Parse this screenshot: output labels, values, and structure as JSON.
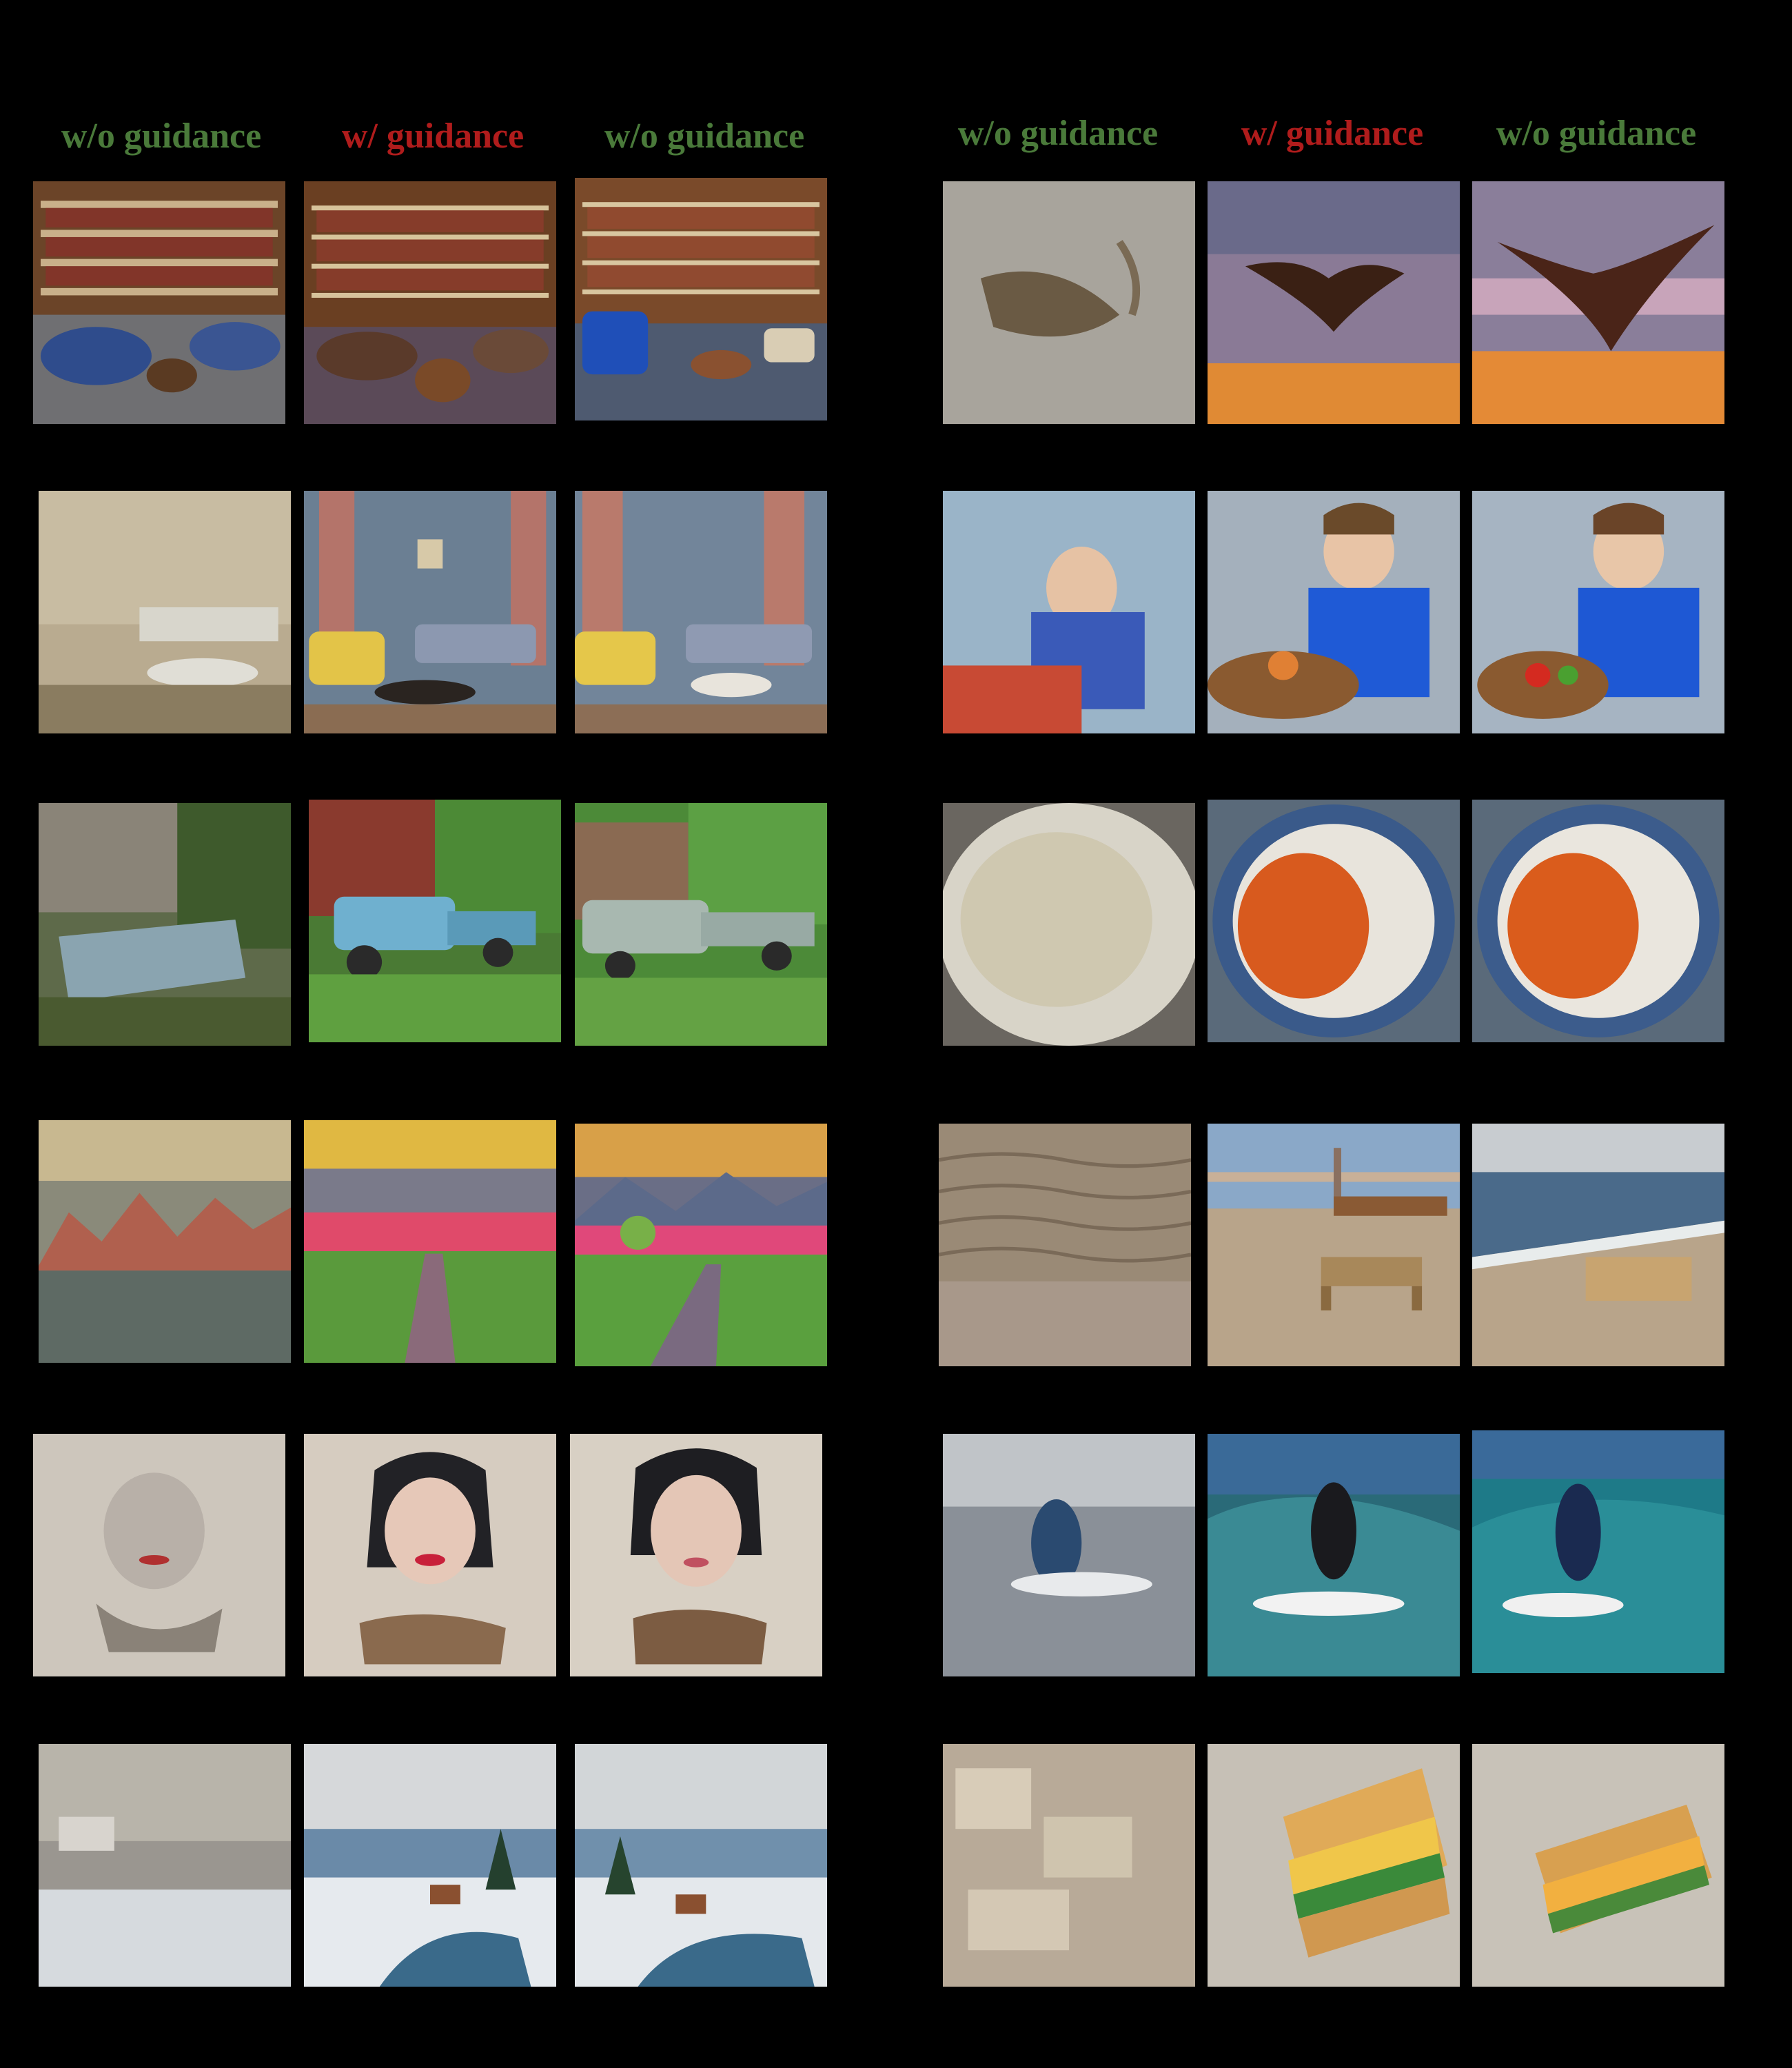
{
  "headers": {
    "left": [
      "w/o guidance",
      "w/ guidance",
      "w/o guidance"
    ],
    "right": [
      "w/o guidance",
      "w/ guidance",
      "w/o guidance"
    ]
  },
  "colors": {
    "header_without_guidance": "#4a7a3a",
    "header_with_guidance": "#b01c1c",
    "background": "#000000"
  },
  "grid": {
    "left": [
      [
        "library-interior-unguided",
        "library-interior-guided",
        "library-interior-unguided-2"
      ],
      [
        "living-room-sketchy",
        "living-room-pink-curtains",
        "living-room-pink-curtains-2"
      ],
      [
        "abandoned-truck-overgrown",
        "blue-pickup-truck-grass",
        "rusty-pickup-truck-barn"
      ],
      [
        "abstract-mountain-landscape",
        "sunset-dirt-road-painting",
        "sunset-road-tree-painting"
      ],
      [
        "sketch-woman-face",
        "watercolor-woman-portrait",
        "watercolor-woman-portrait-2"
      ],
      [
        "hazy-winter-cabin",
        "winter-river-cabin-painting",
        "winter-river-cabin-painting-2"
      ]
    ],
    "right": [
      [
        "blurry-bird-sand",
        "hawk-flying-sunset",
        "hawk-flying-sunset-2"
      ],
      [
        "boy-eating-patterned-bg",
        "boy-eating-blue-shirt",
        "boy-eating-vegetables"
      ],
      [
        "blurry-soup-bowl",
        "curry-with-rice",
        "curry-with-rice-2"
      ],
      [
        "sand-ripples",
        "beach-bench-fence",
        "beach-bench-shore"
      ],
      [
        "blurry-surfer",
        "surfer-wave",
        "surfer-wave-2"
      ],
      [
        "cluttered-sandwiches-blurry",
        "sandwich-closeup",
        "sandwich-closeup-2"
      ]
    ]
  }
}
